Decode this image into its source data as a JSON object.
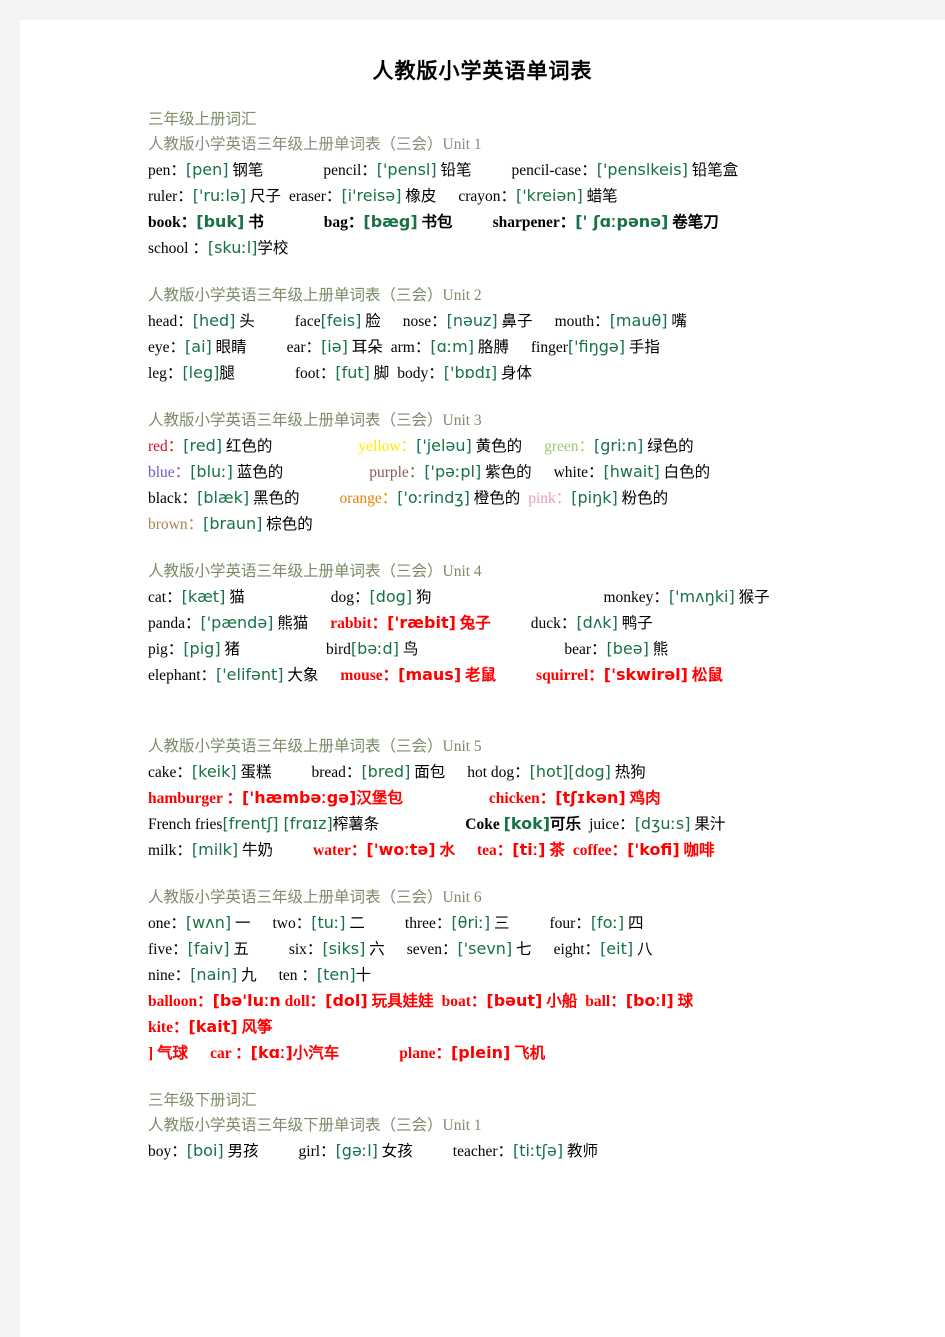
{
  "document": {
    "title": "人教版小学英语单词表",
    "sections": [
      {
        "label": "三年级上册词汇",
        "units": [
          {
            "heading": "人教版小学英语三年级上册单词表（三会）Unit 1",
            "lines": [
              [
                {
                  "en": "pen：",
                  "ph": "[pen]",
                  "cn": "钢笔"
                },
                {
                  "en": "pencil：",
                  "ph": "['pensl]",
                  "cn": "铅笔"
                },
                {
                  "en": "pencil-case：",
                  "ph": "['penslkeis]",
                  "cn": "铅笔盒"
                },
                {
                  "en": "ruler：",
                  "ph": "['ruːlə]",
                  "cn": "尺子"
                },
                {
                  "en": "eraser：",
                  "ph": "[i'reisə]",
                  "cn": "橡皮"
                },
                {
                  "en": "crayon：",
                  "ph": "['kreiən]",
                  "cn": "蜡笔"
                }
              ],
              [
                {
                  "en": "book：",
                  "ph": "[buk]",
                  "cn": "书",
                  "bold": true
                },
                {
                  "en": "bag：",
                  "ph": "[bæg]",
                  "cn": "书包",
                  "bold": true
                },
                {
                  "en": "sharpener：",
                  "ph": "[' ʃɑːpənə]",
                  "cn": "卷笔刀",
                  "bold": true
                },
                {
                  "en": "school ：",
                  "ph": "[skuːl]",
                  "cn": "学校"
                }
              ]
            ]
          },
          {
            "heading": "人教版小学英语三年级上册单词表（三会）Unit 2",
            "lines": [
              [
                {
                  "en": "head：",
                  "ph": "[hed]",
                  "cn": "头"
                },
                {
                  "en": "face",
                  "ph": "[feis]",
                  "cn": "脸"
                },
                {
                  "en": "nose：",
                  "ph": "[nəuz]",
                  "cn": "鼻子"
                },
                {
                  "en": "mouth：",
                  "ph": "[mauθ]",
                  "cn": "嘴"
                },
                {
                  "en": "eye：",
                  "ph": "[ai]",
                  "cn": "眼睛"
                },
                {
                  "en": "ear：",
                  "ph": "[iə]",
                  "cn": "耳朵"
                },
                {
                  "en": "arm：",
                  "ph": "[ɑːm]",
                  "cn": "胳膊"
                },
                {
                  "en": "finger",
                  "ph": "['fiŋgə]",
                  "cn": "手指"
                },
                {
                  "en": "leg：",
                  "ph": "[leg]",
                  "cn": "腿"
                },
                {
                  "en": "foot：",
                  "ph": "[fut]",
                  "cn": "脚"
                },
                {
                  "en": "body：",
                  "ph": "['bɒdɪ]",
                  "cn": "身体"
                }
              ]
            ]
          },
          {
            "heading": "人教版小学英语三年级上册单词表（三会）Unit 3",
            "lines": [
              [
                {
                  "en": "red：",
                  "ph": "[red]",
                  "cn": "红色的",
                  "hue": "c-red"
                },
                {
                  "en": "yellow：",
                  "ph": "['jeləu]",
                  "cn": "黄色的",
                  "hue": "c-yellow"
                },
                {
                  "en": "green：",
                  "ph": "[griːn]",
                  "cn": "绿色的",
                  "hue": "c-green"
                },
                {
                  "en": "blue：",
                  "ph": "[bluː]",
                  "cn": "蓝色的",
                  "hue": "c-blue"
                },
                {
                  "en": "purple：",
                  "ph": "['pəːpl]",
                  "cn": "紫色的",
                  "hue": "c-purple"
                },
                {
                  "en": "white：",
                  "ph": "[hwait]",
                  "cn": "白色的",
                  "hue": "c-white"
                },
                {
                  "en": "black：",
                  "ph": "[blæk]",
                  "cn": "黑色的",
                  "hue": "c-black"
                },
                {
                  "en": "orange：",
                  "ph": "['oːrindʒ]",
                  "cn": "橙色的",
                  "hue": "c-orange"
                },
                {
                  "en": "pink：",
                  "ph": "[piŋk]",
                  "cn": "粉色的",
                  "hue": "c-pink"
                },
                {
                  "en": "brown：",
                  "ph": "[braun]",
                  "cn": "棕色的",
                  "hue": "c-brown"
                }
              ]
            ]
          },
          {
            "heading": "人教版小学英语三年级上册单词表（三会）Unit 4",
            "lines": [
              [
                {
                  "en": "cat：",
                  "ph": "[kæt]",
                  "cn": "猫"
                },
                {
                  "en": "dog：",
                  "ph": "[dog]",
                  "cn": "狗"
                },
                {
                  "en": "monkey：",
                  "ph": "['mʌŋki]",
                  "cn": "猴子"
                },
                {
                  "en": "panda：",
                  "ph": "['pændə]",
                  "cn": "熊猫"
                },
                {
                  "en": "rabbit：",
                  "ph": "['ræbit]",
                  "cn": "兔子",
                  "red": true,
                  "bold": true
                },
                {
                  "en": "duck：",
                  "ph": "[dʌk]",
                  "cn": "鸭子"
                },
                {
                  "en": "pig：",
                  "ph": "[pig]",
                  "cn": "猪"
                },
                {
                  "en": "bird",
                  "ph": "[bəːd]",
                  "cn": "鸟"
                },
                {
                  "en": "bear：",
                  "ph": "[beə]",
                  "cn": "熊"
                },
                {
                  "en": "elephant：",
                  "ph": "['elifənt]",
                  "cn": "大象"
                },
                {
                  "en": "mouse：",
                  "ph": "[maus]",
                  "cn": "老鼠",
                  "red": true,
                  "bold": true
                },
                {
                  "en": "squirrel：",
                  "ph": "['skwirəl]",
                  "cn": "松鼠",
                  "red": true,
                  "bold": true
                }
              ]
            ]
          },
          {
            "heading": "人教版小学英语三年级上册单词表（三会）Unit 5",
            "lines": [
              [
                {
                  "en": "cake：",
                  "ph": "[keik]",
                  "cn": "蛋糕"
                },
                {
                  "en": "bread：",
                  "ph": "[bred]",
                  "cn": "面包"
                },
                {
                  "en": "hot dog：",
                  "ph": "[hot][dog]",
                  "cn": "热狗"
                },
                {
                  "en": "hamburger ：",
                  "ph": "['hæmbəːgə]",
                  "cn": "汉堡包",
                  "red": true,
                  "bold": true
                },
                {
                  "en": "chicken：",
                  "ph": "[tʃɪkən]",
                  "cn": "鸡肉",
                  "red": true,
                  "bold": true
                },
                {
                  "en": "French fries",
                  "ph": "[frentʃ] [frɑɪz]",
                  "cn": "榨薯条"
                },
                {
                  "en": "Coke",
                  "ph": "[kok]",
                  "cn": "可乐",
                  "bold": true
                },
                {
                  "en": "juice：",
                  "ph": "[dʒuːs]",
                  "cn": "果汁"
                },
                {
                  "en": "milk：",
                  "ph": "[milk]",
                  "cn": "牛奶"
                },
                {
                  "en": "water：",
                  "ph": "['woːtə]",
                  "cn": "水",
                  "red": true,
                  "bold": true
                },
                {
                  "en": "tea：",
                  "ph": "[tiː]",
                  "cn": "茶",
                  "red": true,
                  "bold": true
                },
                {
                  "en": "coffee：",
                  "ph": "['kofi]",
                  "cn": "咖啡",
                  "red": true,
                  "bold": true
                }
              ]
            ]
          },
          {
            "heading": "人教版小学英语三年级上册单词表（三会）Unit 6",
            "lines": [
              [
                {
                  "en": "one：",
                  "ph": "[wʌn]",
                  "cn": "一"
                },
                {
                  "en": "two：",
                  "ph": "[tuː]",
                  "cn": "二"
                },
                {
                  "en": "three：",
                  "ph": "[θriː]",
                  "cn": "三"
                },
                {
                  "en": "four：",
                  "ph": "[foː]",
                  "cn": "四"
                },
                {
                  "en": "five：",
                  "ph": "[faiv]",
                  "cn": "五"
                },
                {
                  "en": "six：",
                  "ph": "[siks]",
                  "cn": "六"
                },
                {
                  "en": "seven：",
                  "ph": "['sevn]",
                  "cn": "七"
                },
                {
                  "en": "eight：",
                  "ph": "[eit]",
                  "cn": "八"
                },
                {
                  "en": "nine：",
                  "ph": "[nain]",
                  "cn": "九"
                },
                {
                  "en": "ten ：",
                  "ph": "[ten]",
                  "cn": "十"
                },
                {
                  "en": "balloon：",
                  "ph": "[bə'luːn",
                  "cn": "",
                  "red": true,
                  "bold": true
                },
                {
                  "en": "doll：",
                  "ph": "[dol]",
                  "cn": "玩具娃娃",
                  "red": true,
                  "bold": true
                },
                {
                  "en": "boat：",
                  "ph": "[bəut]",
                  "cn": "小船",
                  "red": true,
                  "bold": true
                },
                {
                  "en": "ball：",
                  "ph": "[boːl]",
                  "cn": "球",
                  "red": true,
                  "bold": true
                },
                {
                  "en": "kite：",
                  "ph": "[kait]",
                  "cn": "风筝",
                  "red": true,
                  "bold": true
                },
                {
                  "en": "]",
                  "ph": "",
                  "cn": "气球",
                  "red": true,
                  "bold": true
                },
                {
                  "en": "car ：",
                  "ph": "[kɑː]",
                  "cn": "小汽车",
                  "red": true,
                  "bold": true
                },
                {
                  "en": "plane：",
                  "ph": "[plein]",
                  "cn": "飞机",
                  "red": true,
                  "bold": true
                }
              ]
            ]
          }
        ]
      },
      {
        "label": "三年级下册词汇",
        "units": [
          {
            "heading": "人教版小学英语三年级下册单词表（三会）Unit 1",
            "lines": [
              [
                {
                  "en": "boy：",
                  "ph": "[boi]",
                  "cn": "男孩"
                },
                {
                  "en": "girl：",
                  "ph": "[gəːl]",
                  "cn": "女孩"
                },
                {
                  "en": "teacher：",
                  "ph": "[tiːtʃə]",
                  "cn": "教师"
                }
              ]
            ]
          }
        ]
      }
    ]
  },
  "colors": {
    "phonetic": "#177245",
    "highlight_red": "#ff0000",
    "section_label": "#7c8a6a",
    "unit_heading": "#8a8a7a",
    "page_background": "#ffffff",
    "outer_background": "#f3f3f4"
  }
}
